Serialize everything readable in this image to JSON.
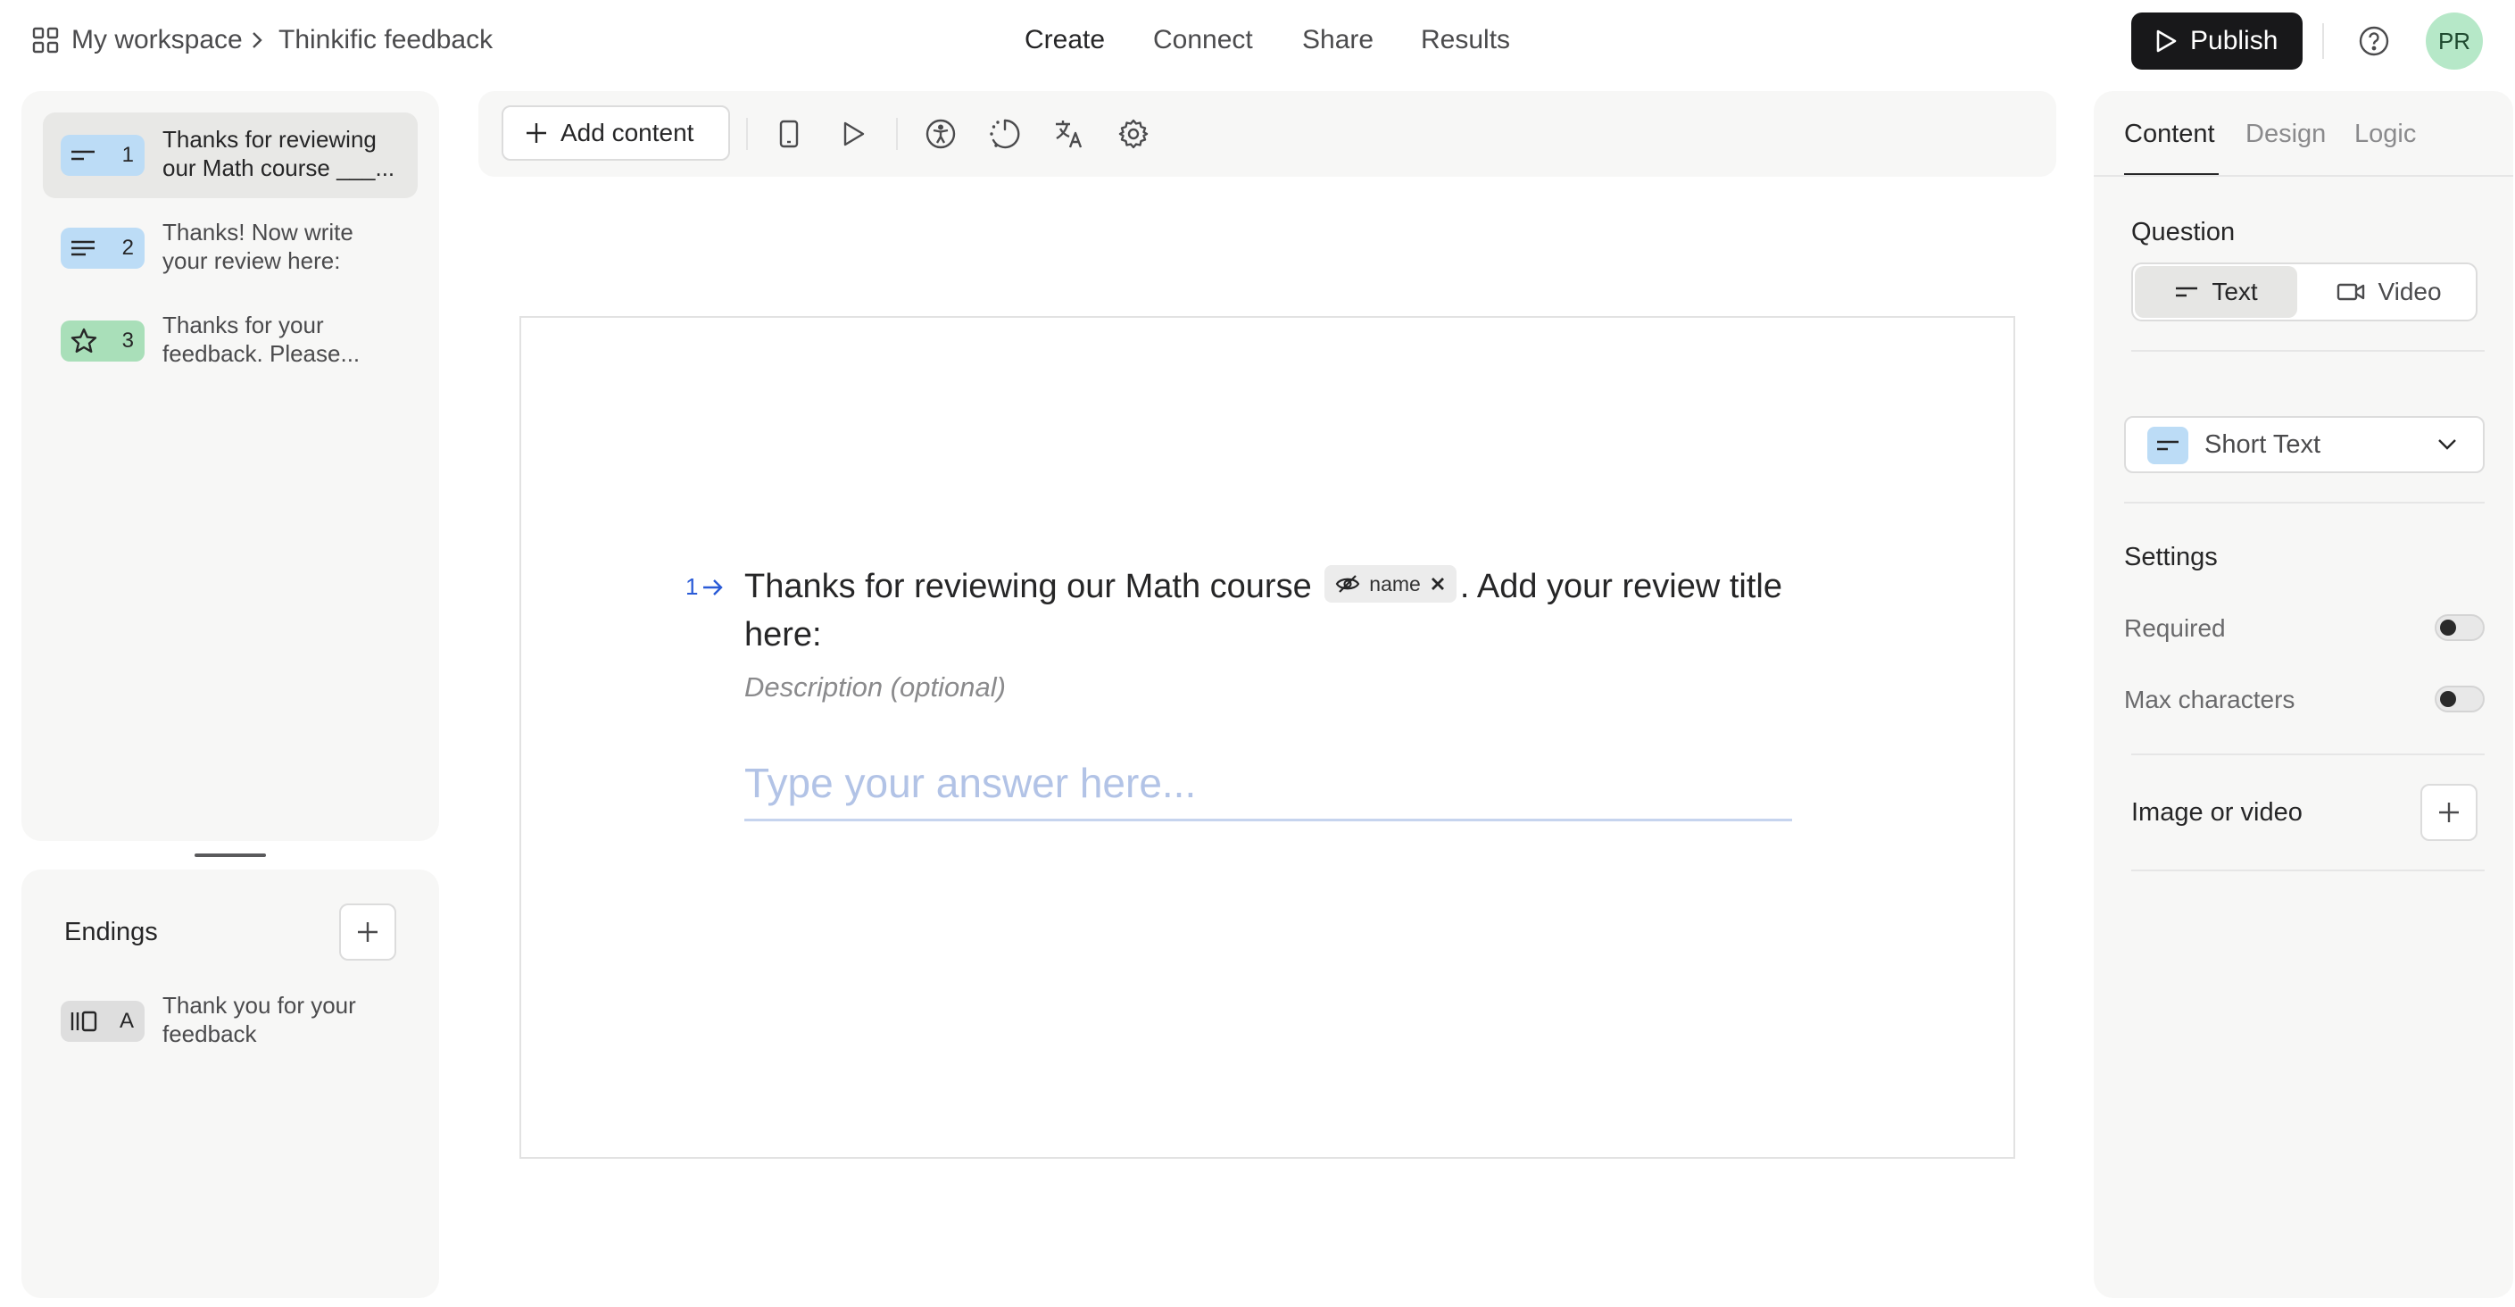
{
  "header": {
    "breadcrumb": {
      "workspace": "My workspace",
      "separator": ">",
      "form_name": "Thinkific feedback"
    },
    "nav": [
      "Create",
      "Connect",
      "Share",
      "Results"
    ],
    "active_nav": "Create",
    "publish_label": "Publish",
    "avatar_initials": "PR",
    "icons": [
      "grid-icon",
      "chevron-right-icon",
      "play-outline-icon",
      "help-circle-icon"
    ]
  },
  "questions": [
    {
      "number": "1",
      "text": "Thanks for reviewing our Math course ___...",
      "icon": "short-text-icon",
      "color": "#bcdcf6",
      "selected": true
    },
    {
      "number": "2",
      "text": "Thanks! Now write your review here:",
      "icon": "long-text-icon",
      "color": "#bcdcf6",
      "selected": false
    },
    {
      "number": "3",
      "text": "Thanks for your feedback. Please...",
      "icon": "star-icon",
      "color": "#a9dfb9",
      "selected": false
    }
  ],
  "endings": {
    "title": "Endings",
    "items": [
      {
        "letter": "A",
        "text": "Thank you for your feedback",
        "icon": "ending-icon"
      }
    ]
  },
  "toolbar": {
    "add_content_label": "Add content",
    "icons": [
      "mobile-preview-icon",
      "play-preview-icon",
      "accessibility-icon",
      "loading-animation-icon",
      "translate-icon",
      "gear-icon"
    ]
  },
  "canvas": {
    "question_number": "1",
    "title_before": "Thanks for reviewing our Math course",
    "variable_chip": "name",
    "title_after": ". Add your review title here:",
    "description_placeholder": "Description (optional)",
    "answer_placeholder": "Type your answer here..."
  },
  "right_panel": {
    "tabs": [
      "Content",
      "Design",
      "Logic"
    ],
    "active_tab": "Content",
    "question_label": "Question",
    "question_types": {
      "text": "Text",
      "video": "Video",
      "selected": "Text"
    },
    "answer_type": "Short Text",
    "settings_label": "Settings",
    "settings": [
      {
        "label": "Required",
        "on": false
      },
      {
        "label": "Max characters",
        "on": false
      }
    ],
    "image_or_video_label": "Image or video"
  },
  "colors": {
    "accent_blue": "#2a5bd7",
    "short_text_badge": "#bcdcf6",
    "rating_badge": "#a9dfb9",
    "publish_bg": "#18181a",
    "avatar_bg": "#b6e8c8",
    "panel_bg": "#f7f7f6"
  }
}
